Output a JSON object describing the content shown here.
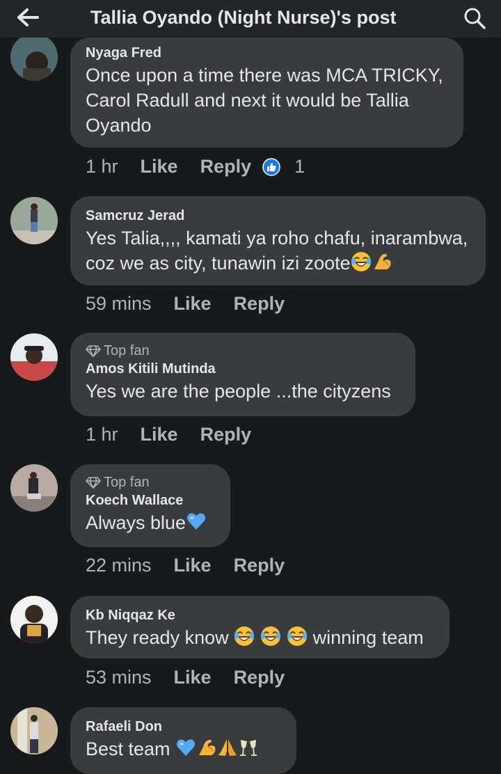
{
  "header": {
    "title": "Tallia Oyando (Night Nurse)'s post"
  },
  "comments": [
    {
      "name": "Nyaga Fred",
      "text_lines": [
        "Once upon a time there was MCA TRICKY,",
        "Carol Radull and next it would be Tallia",
        "Oyando"
      ],
      "time": "1 hr",
      "like": "Like",
      "reply": "Reply",
      "reaction_count": "1"
    },
    {
      "name": "Samcruz Jerad",
      "text_lines": [
        "Yes Talia,,,, kamati ya roho chafu, inarambwa,",
        "coz we as city, tunawin izi zoote"
      ],
      "time": "59 mins",
      "like": "Like",
      "reply": "Reply"
    },
    {
      "badge": "Top fan",
      "name": "Amos Kitili Mutinda",
      "text": "Yes we are the people ...the cityzens",
      "time": "1 hr",
      "like": "Like",
      "reply": "Reply"
    },
    {
      "badge": "Top fan",
      "name": "Koech Wallace",
      "text": "Always blue",
      "time": "22 mins",
      "like": "Like",
      "reply": "Reply"
    },
    {
      "name": "Kb Niqqaz Ke",
      "text_a": "They ready know",
      "text_b": "winning team",
      "time": "53 mins",
      "like": "Like",
      "reply": "Reply"
    },
    {
      "name": "Rafaeli Don",
      "text": "Best team"
    }
  ],
  "icons": {
    "header": [
      "back-arrow-icon",
      "search-icon"
    ],
    "reaction": "like-reaction-icon",
    "badge": "diamond-icon",
    "emoji": [
      "laughing-emoji",
      "flexed-biceps-emoji",
      "blue-heart-emoji",
      "folded-hands-emoji",
      "clinking-glasses-emoji"
    ]
  },
  "colors": {
    "background": "#18191a",
    "bubble": "#3a3b3c",
    "like_blue": "#1877f2",
    "secondary_text": "#b0b3b8"
  }
}
